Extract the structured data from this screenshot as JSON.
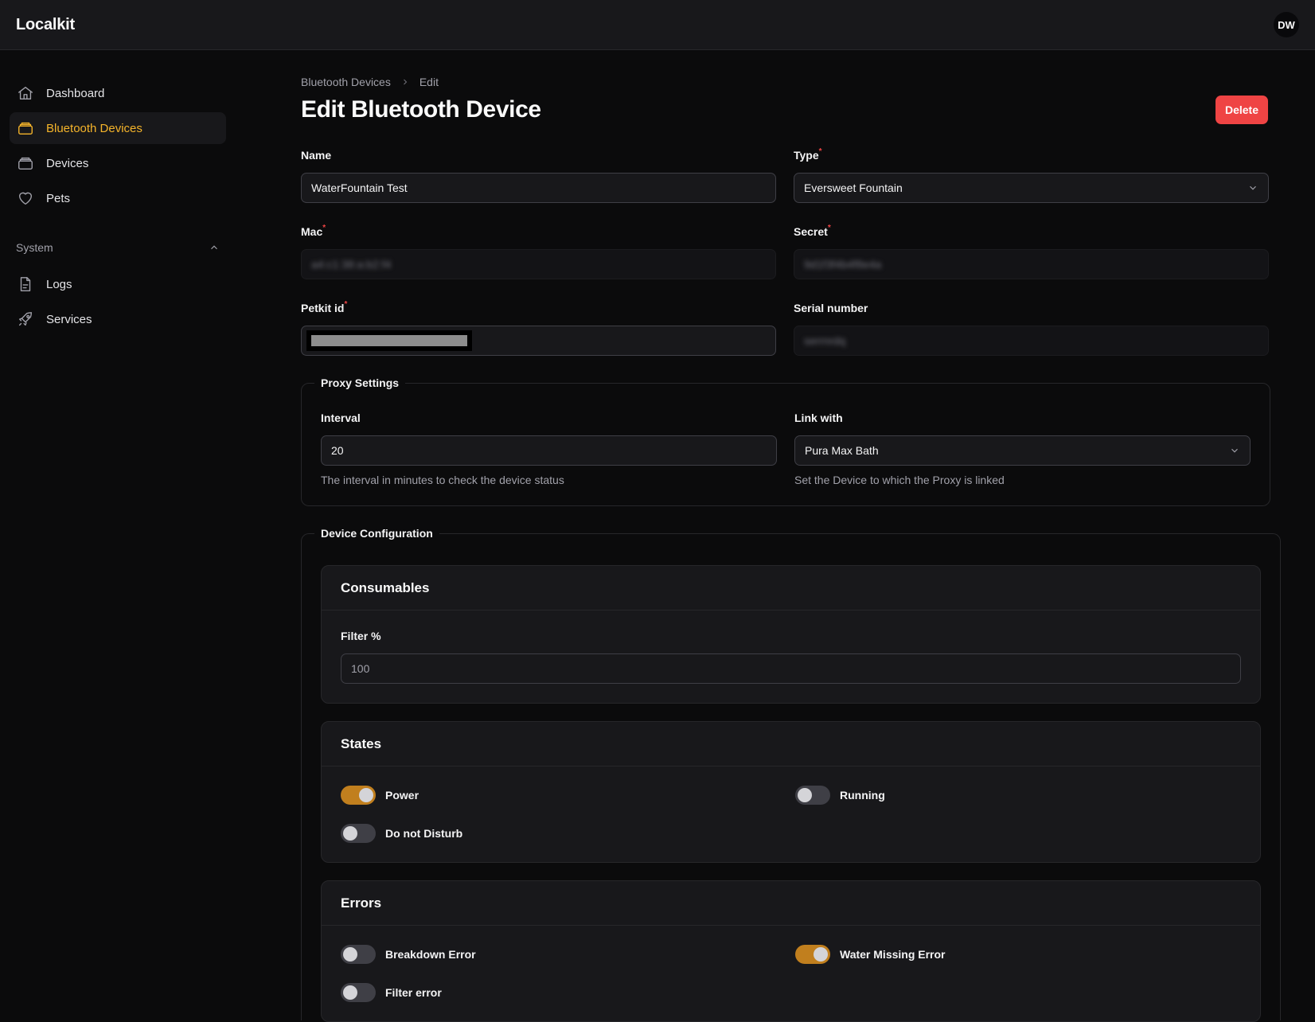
{
  "app": {
    "brand": "Localkit",
    "avatar_initials": "DW"
  },
  "sidebar": {
    "items": [
      {
        "label": "Dashboard",
        "icon": "home-icon"
      },
      {
        "label": "Bluetooth Devices",
        "icon": "stack-icon",
        "active": true
      },
      {
        "label": "Devices",
        "icon": "stack-icon"
      },
      {
        "label": "Pets",
        "icon": "heart-icon"
      }
    ],
    "group": {
      "label": "System",
      "items": [
        {
          "label": "Logs",
          "icon": "document-icon"
        },
        {
          "label": "Services",
          "icon": "rocket-icon"
        }
      ]
    }
  },
  "breadcrumb": {
    "parent": "Bluetooth Devices",
    "current": "Edit"
  },
  "page": {
    "title": "Edit Bluetooth Device",
    "delete_label": "Delete"
  },
  "form": {
    "name": {
      "label": "Name",
      "value": "WaterFountain Test"
    },
    "type": {
      "label": "Type",
      "value": "Eversweet Fountain"
    },
    "mac": {
      "label": "Mac",
      "value": "a4:c1:38:a:b2:f4"
    },
    "secret": {
      "label": "Secret",
      "value": "9d1f3f4b4f8e4a"
    },
    "petkit_id": {
      "label": "Petkit id"
    },
    "serial": {
      "label": "Serial number",
      "value": "serrnrdq"
    }
  },
  "proxy": {
    "legend": "Proxy Settings",
    "interval": {
      "label": "Interval",
      "value": "20",
      "hint": "The interval in minutes to check the device status"
    },
    "link": {
      "label": "Link with",
      "value": "Pura Max Bath",
      "hint": "Set the Device to which the Proxy is linked"
    }
  },
  "config": {
    "legend": "Device Configuration",
    "consumables": {
      "title": "Consumables",
      "filter_label": "Filter %",
      "filter_value": "100"
    },
    "states": {
      "title": "States",
      "power": "Power",
      "running": "Running",
      "dnd": "Do not Disturb"
    },
    "errors": {
      "title": "Errors",
      "breakdown": "Breakdown Error",
      "water_missing": "Water Missing Error",
      "filter": "Filter error"
    }
  },
  "colors": {
    "accent": "#f5b42a",
    "danger": "#ef4444",
    "toggle_on": "#c17f1e"
  }
}
